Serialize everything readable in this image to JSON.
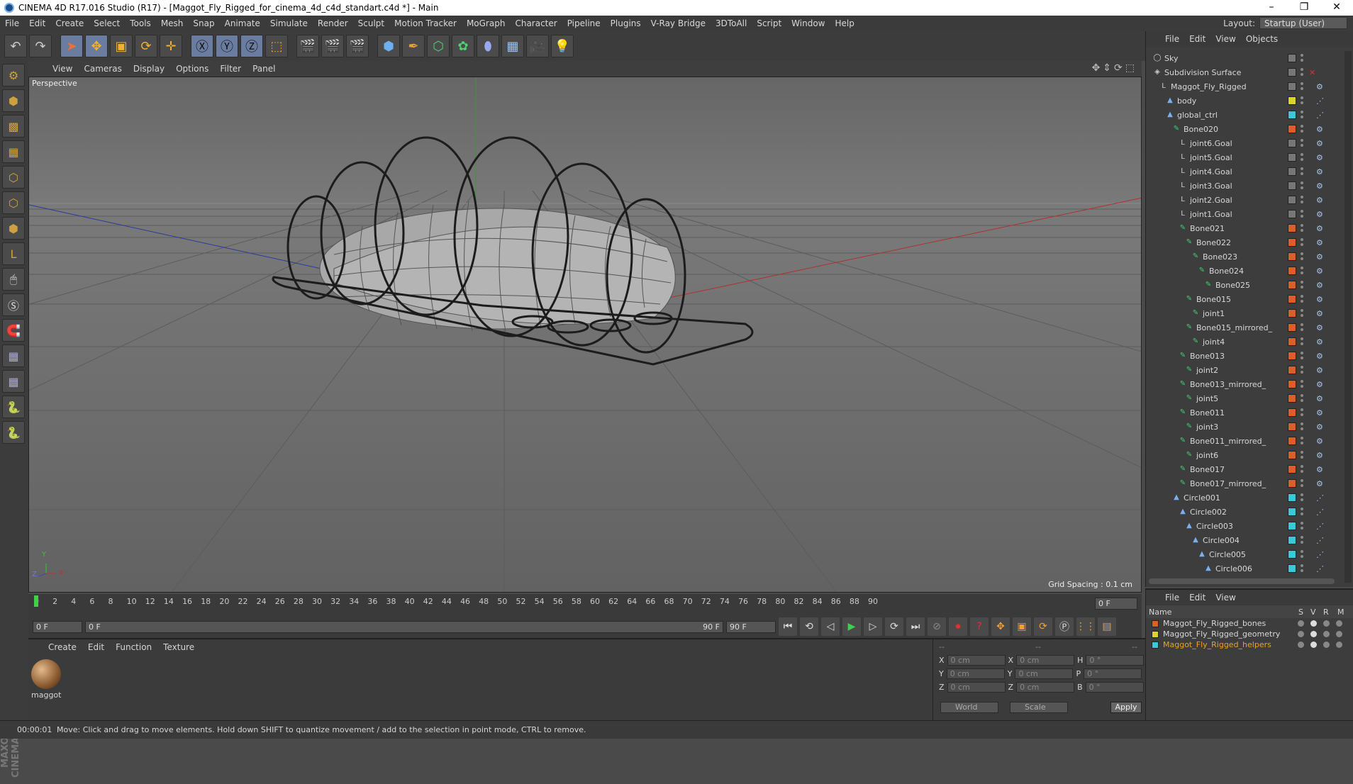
{
  "window": {
    "title": "CINEMA 4D R17.016 Studio (R17) - [Maggot_Fly_Rigged_for_cinema_4d_c4d_standart.c4d *] - Main",
    "min": "–",
    "restore": "❐",
    "close": "✕"
  },
  "menu": [
    "File",
    "Edit",
    "Create",
    "Select",
    "Tools",
    "Mesh",
    "Snap",
    "Animate",
    "Simulate",
    "Render",
    "Sculpt",
    "Motion Tracker",
    "MoGraph",
    "Character",
    "Pipeline",
    "Plugins",
    "V-Ray Bridge",
    "3DToAll",
    "Script",
    "Window",
    "Help"
  ],
  "layout": {
    "label": "Layout:",
    "value": "Startup (User)"
  },
  "viewport": {
    "menu": [
      "View",
      "Cameras",
      "Display",
      "Options",
      "Filter",
      "Panel"
    ],
    "label": "Perspective",
    "grid_spacing": "Grid Spacing : 0.1 cm",
    "axis_y": "Y",
    "axis_x": "X",
    "axis_z": "Z"
  },
  "objects": {
    "menu": [
      "File",
      "Edit",
      "View",
      "Objects"
    ],
    "items": [
      {
        "name": "Sky",
        "indent": 0,
        "tag": "#777",
        "icon": "◯"
      },
      {
        "name": "Subdivision Surface",
        "indent": 0,
        "tag": "#777",
        "icon": "◈",
        "x": true
      },
      {
        "name": "Maggot_Fly_Rigged",
        "indent": 1,
        "tag": "#777",
        "icon": "L"
      },
      {
        "name": "body",
        "indent": 2,
        "tag": "#d9d430",
        "icon": "▲"
      },
      {
        "name": "global_ctrl",
        "indent": 2,
        "tag": "#3cc8d8",
        "icon": "▲"
      },
      {
        "name": "Bone020",
        "indent": 3,
        "tag": "#d8602a",
        "icon": "✎"
      },
      {
        "name": "joint6.Goal",
        "indent": 4,
        "tag": "#777",
        "icon": "L"
      },
      {
        "name": "joint5.Goal",
        "indent": 4,
        "tag": "#777",
        "icon": "L"
      },
      {
        "name": "joint4.Goal",
        "indent": 4,
        "tag": "#777",
        "icon": "L"
      },
      {
        "name": "joint3.Goal",
        "indent": 4,
        "tag": "#777",
        "icon": "L"
      },
      {
        "name": "joint2.Goal",
        "indent": 4,
        "tag": "#777",
        "icon": "L"
      },
      {
        "name": "joint1.Goal",
        "indent": 4,
        "tag": "#777",
        "icon": "L"
      },
      {
        "name": "Bone021",
        "indent": 4,
        "tag": "#d8602a",
        "icon": "✎"
      },
      {
        "name": "Bone022",
        "indent": 5,
        "tag": "#d8602a",
        "icon": "✎"
      },
      {
        "name": "Bone023",
        "indent": 6,
        "tag": "#d8602a",
        "icon": "✎"
      },
      {
        "name": "Bone024",
        "indent": 7,
        "tag": "#d8602a",
        "icon": "✎"
      },
      {
        "name": "Bone025",
        "indent": 8,
        "tag": "#d8602a",
        "icon": "✎"
      },
      {
        "name": "Bone015",
        "indent": 5,
        "tag": "#d8602a",
        "icon": "✎"
      },
      {
        "name": "joint1",
        "indent": 6,
        "tag": "#d8602a",
        "icon": "✎"
      },
      {
        "name": "Bone015_mirrored_",
        "indent": 5,
        "tag": "#d8602a",
        "icon": "✎"
      },
      {
        "name": "joint4",
        "indent": 6,
        "tag": "#d8602a",
        "icon": "✎"
      },
      {
        "name": "Bone013",
        "indent": 4,
        "tag": "#d8602a",
        "icon": "✎"
      },
      {
        "name": "joint2",
        "indent": 5,
        "tag": "#d8602a",
        "icon": "✎"
      },
      {
        "name": "Bone013_mirrored_",
        "indent": 4,
        "tag": "#d8602a",
        "icon": "✎"
      },
      {
        "name": "joint5",
        "indent": 5,
        "tag": "#d8602a",
        "icon": "✎"
      },
      {
        "name": "Bone011",
        "indent": 4,
        "tag": "#d8602a",
        "icon": "✎"
      },
      {
        "name": "joint3",
        "indent": 5,
        "tag": "#d8602a",
        "icon": "✎"
      },
      {
        "name": "Bone011_mirrored_",
        "indent": 4,
        "tag": "#d8602a",
        "icon": "✎"
      },
      {
        "name": "joint6",
        "indent": 5,
        "tag": "#d8602a",
        "icon": "✎"
      },
      {
        "name": "Bone017",
        "indent": 4,
        "tag": "#d8602a",
        "icon": "✎"
      },
      {
        "name": "Bone017_mirrored_",
        "indent": 4,
        "tag": "#d8602a",
        "icon": "✎"
      },
      {
        "name": "Circle001",
        "indent": 3,
        "tag": "#3cc8d8",
        "icon": "▲"
      },
      {
        "name": "Circle002",
        "indent": 4,
        "tag": "#3cc8d8",
        "icon": "▲"
      },
      {
        "name": "Circle003",
        "indent": 5,
        "tag": "#3cc8d8",
        "icon": "▲"
      },
      {
        "name": "Circle004",
        "indent": 6,
        "tag": "#3cc8d8",
        "icon": "▲"
      },
      {
        "name": "Circle005",
        "indent": 7,
        "tag": "#3cc8d8",
        "icon": "▲"
      },
      {
        "name": "Circle006",
        "indent": 8,
        "tag": "#3cc8d8",
        "icon": "▲"
      }
    ]
  },
  "layers": {
    "menu": [
      "File",
      "Edit",
      "View"
    ],
    "headers": {
      "name": "Name",
      "s": "S",
      "v": "V",
      "r": "R",
      "m": "M"
    },
    "items": [
      {
        "name": "Maggot_Fly_Rigged_bones",
        "color": "#d8602a",
        "text": "#d8d8d8"
      },
      {
        "name": "Maggot_Fly_Rigged_geometry",
        "color": "#d9d430",
        "text": "#d8d8d8"
      },
      {
        "name": "Maggot_Fly_Rigged_helpers",
        "color": "#3cc8d8",
        "text": "#f0a020"
      }
    ]
  },
  "timeline": {
    "ticks": [
      "0",
      "2",
      "4",
      "6",
      "8",
      "10",
      "12",
      "14",
      "16",
      "18",
      "20",
      "22",
      "24",
      "26",
      "28",
      "30",
      "32",
      "34",
      "36",
      "38",
      "40",
      "42",
      "44",
      "46",
      "48",
      "50",
      "52",
      "54",
      "56",
      "58",
      "60",
      "62",
      "64",
      "66",
      "68",
      "70",
      "72",
      "74",
      "76",
      "78",
      "80",
      "82",
      "84",
      "86",
      "88",
      "90"
    ],
    "current": "0 F"
  },
  "playback": {
    "start": "0 F",
    "range_start": "0 F",
    "range_end": "90 F",
    "end": "90 F"
  },
  "material": {
    "menu": [
      "Create",
      "Edit",
      "Function",
      "Texture"
    ],
    "name": "maggot"
  },
  "coords": {
    "headers": [
      "--",
      "--",
      "--"
    ],
    "rows": [
      {
        "a": "X",
        "av": "0 cm",
        "b": "X",
        "bv": "0 cm",
        "c": "H",
        "cv": "0 °"
      },
      {
        "a": "Y",
        "av": "0 cm",
        "b": "Y",
        "bv": "0 cm",
        "c": "P",
        "cv": "0 °"
      },
      {
        "a": "Z",
        "av": "0 cm",
        "b": "Z",
        "bv": "0 cm",
        "c": "B",
        "cv": "0 °"
      }
    ],
    "world": "World",
    "scale": "Scale",
    "apply": "Apply"
  },
  "status": {
    "time": "00:00:01",
    "message": "Move: Click and drag to move elements. Hold down SHIFT to quantize movement / add to the selection in point mode, CTRL to remove."
  }
}
